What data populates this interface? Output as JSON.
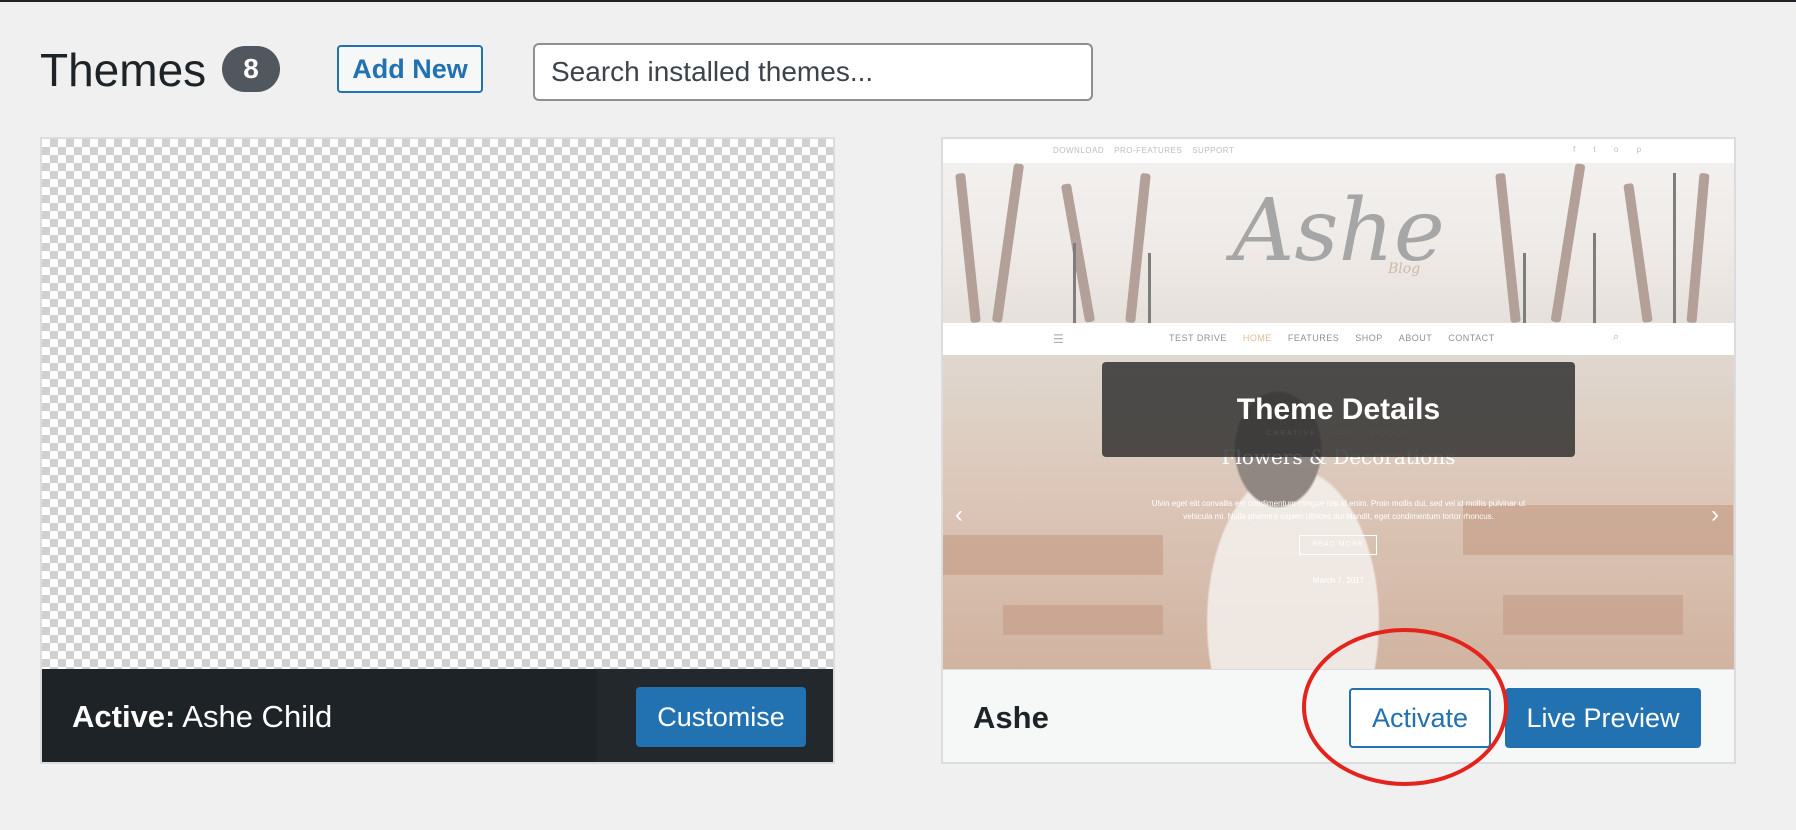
{
  "header": {
    "title": "Themes",
    "count": "8",
    "add_new_label": "Add New",
    "search_placeholder": "Search installed themes..."
  },
  "themes": [
    {
      "name": "Ashe Child",
      "active_prefix": "Active:",
      "customise_label": "Customise"
    },
    {
      "name": "Ashe",
      "theme_details_label": "Theme Details",
      "activate_label": "Activate",
      "live_preview_label": "Live Preview",
      "preview": {
        "top_links": [
          "DOWNLOAD",
          "PRO-FEATURES",
          "SUPPORT"
        ],
        "logo": "Ashe",
        "logo_sub": "Blog",
        "nav_items": [
          "TEST DRIVE",
          "HOME",
          "FEATURES",
          "SHOP",
          "ABOUT",
          "CONTACT"
        ],
        "slider_kicker": "CREATIVE · FOOD · BRANDS",
        "slider_title": "Flowers & Decorations",
        "slider_text": "Ulvin eget elit convallis est condimentum congue nisi id enim. Proin mollis dui, sed vel id mollis pulvinar ut vehicula mi. Nulla pharetra sapien ultrices dui blandit, eget condimentum tortor rhoncus.",
        "read_more": "READ MORE",
        "date": "March 7, 2017"
      }
    }
  ],
  "colors": {
    "primary": "#2271b1",
    "active_footer": "#1d2327",
    "annotation": "#e3231c"
  }
}
